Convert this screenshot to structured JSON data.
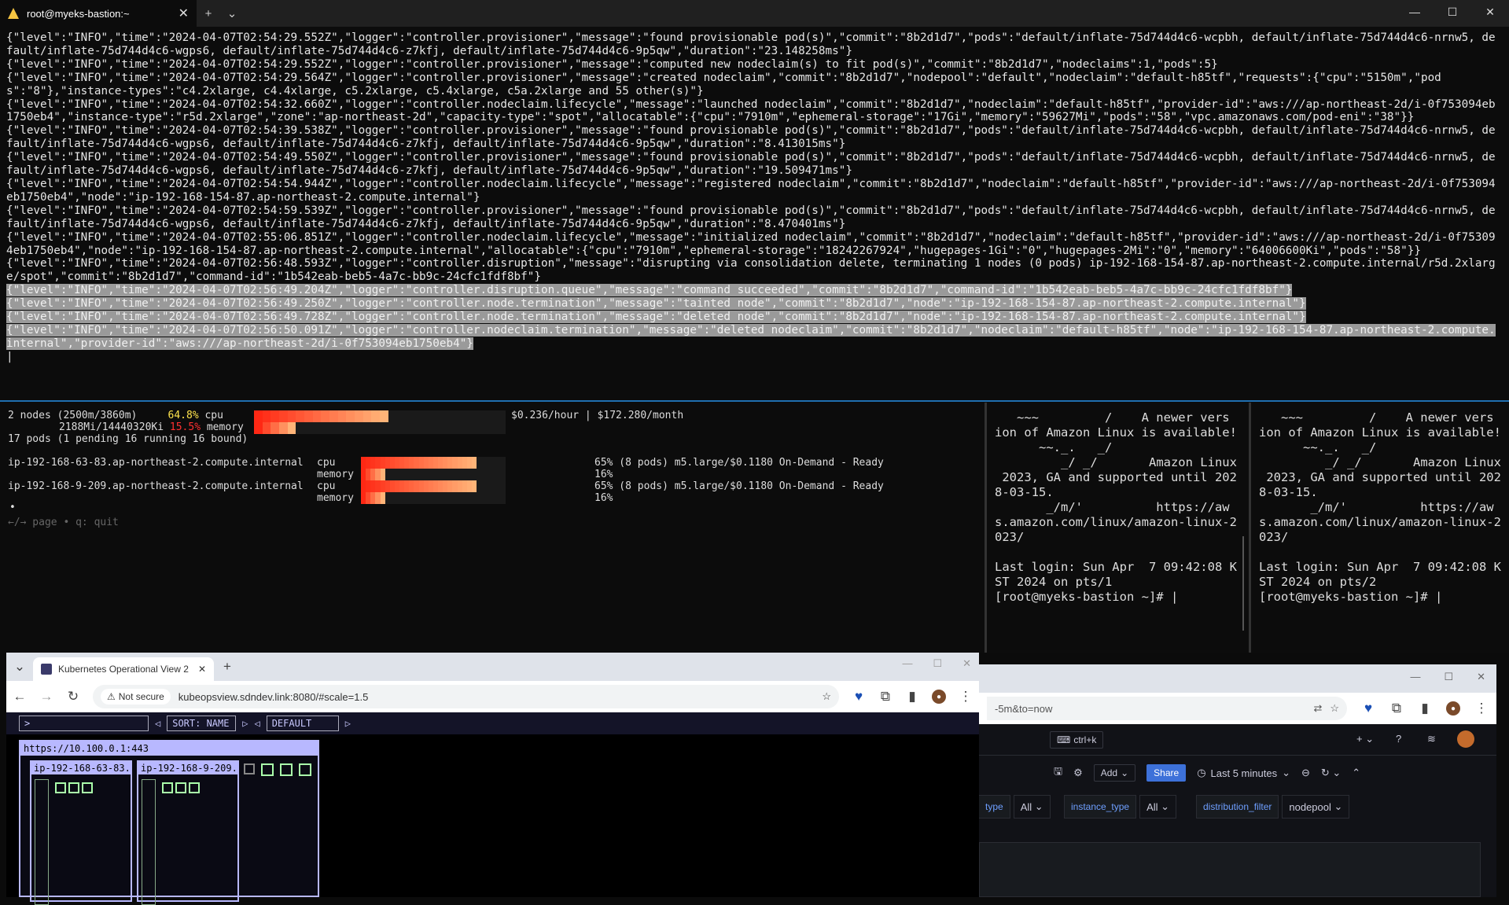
{
  "terminal": {
    "tab_title": "root@myeks-bastion:~",
    "new_tab": "+",
    "dropdown": "⌄",
    "close": "✕",
    "log_lines": [
      "{\"level\":\"INFO\",\"time\":\"2024-04-07T02:54:29.552Z\",\"logger\":\"controller.provisioner\",\"message\":\"found provisionable pod(s)\",\"commit\":\"8b2d1d7\",\"pods\":\"default/inflate-75d744d4c6-wcpbh, default/inflate-75d744d4c6-nrnw5, default/inflate-75d744d4c6-wgps6, default/inflate-75d744d4c6-z7kfj, default/inflate-75d744d4c6-9p5qw\",\"duration\":\"23.148258ms\"}",
      "{\"level\":\"INFO\",\"time\":\"2024-04-07T02:54:29.552Z\",\"logger\":\"controller.provisioner\",\"message\":\"computed new nodeclaim(s) to fit pod(s)\",\"commit\":\"8b2d1d7\",\"nodeclaims\":1,\"pods\":5}",
      "{\"level\":\"INFO\",\"time\":\"2024-04-07T02:54:29.564Z\",\"logger\":\"controller.provisioner\",\"message\":\"created nodeclaim\",\"commit\":\"8b2d1d7\",\"nodepool\":\"default\",\"nodeclaim\":\"default-h85tf\",\"requests\":{\"cpu\":\"5150m\",\"pods\":\"8\"},\"instance-types\":\"c4.2xlarge, c4.4xlarge, c5.2xlarge, c5.4xlarge, c5a.2xlarge and 55 other(s)\"}",
      "{\"level\":\"INFO\",\"time\":\"2024-04-07T02:54:32.660Z\",\"logger\":\"controller.nodeclaim.lifecycle\",\"message\":\"launched nodeclaim\",\"commit\":\"8b2d1d7\",\"nodeclaim\":\"default-h85tf\",\"provider-id\":\"aws:///ap-northeast-2d/i-0f753094eb1750eb4\",\"instance-type\":\"r5d.2xlarge\",\"zone\":\"ap-northeast-2d\",\"capacity-type\":\"spot\",\"allocatable\":{\"cpu\":\"7910m\",\"ephemeral-storage\":\"17Gi\",\"memory\":\"59627Mi\",\"pods\":\"58\",\"vpc.amazonaws.com/pod-eni\":\"38\"}}",
      "{\"level\":\"INFO\",\"time\":\"2024-04-07T02:54:39.538Z\",\"logger\":\"controller.provisioner\",\"message\":\"found provisionable pod(s)\",\"commit\":\"8b2d1d7\",\"pods\":\"default/inflate-75d744d4c6-wcpbh, default/inflate-75d744d4c6-nrnw5, default/inflate-75d744d4c6-wgps6, default/inflate-75d744d4c6-z7kfj, default/inflate-75d744d4c6-9p5qw\",\"duration\":\"8.413015ms\"}",
      "{\"level\":\"INFO\",\"time\":\"2024-04-07T02:54:49.550Z\",\"logger\":\"controller.provisioner\",\"message\":\"found provisionable pod(s)\",\"commit\":\"8b2d1d7\",\"pods\":\"default/inflate-75d744d4c6-wcpbh, default/inflate-75d744d4c6-nrnw5, default/inflate-75d744d4c6-wgps6, default/inflate-75d744d4c6-z7kfj, default/inflate-75d744d4c6-9p5qw\",\"duration\":\"19.509471ms\"}",
      "{\"level\":\"INFO\",\"time\":\"2024-04-07T02:54:54.944Z\",\"logger\":\"controller.nodeclaim.lifecycle\",\"message\":\"registered nodeclaim\",\"commit\":\"8b2d1d7\",\"nodeclaim\":\"default-h85tf\",\"provider-id\":\"aws:///ap-northeast-2d/i-0f753094eb1750eb4\",\"node\":\"ip-192-168-154-87.ap-northeast-2.compute.internal\"}",
      "{\"level\":\"INFO\",\"time\":\"2024-04-07T02:54:59.539Z\",\"logger\":\"controller.provisioner\",\"message\":\"found provisionable pod(s)\",\"commit\":\"8b2d1d7\",\"pods\":\"default/inflate-75d744d4c6-wcpbh, default/inflate-75d744d4c6-nrnw5, default/inflate-75d744d4c6-wgps6, default/inflate-75d744d4c6-z7kfj, default/inflate-75d744d4c6-9p5qw\",\"duration\":\"8.470401ms\"}",
      "{\"level\":\"INFO\",\"time\":\"2024-04-07T02:55:06.851Z\",\"logger\":\"controller.nodeclaim.lifecycle\",\"message\":\"initialized nodeclaim\",\"commit\":\"8b2d1d7\",\"nodeclaim\":\"default-h85tf\",\"provider-id\":\"aws:///ap-northeast-2d/i-0f753094eb1750eb4\",\"node\":\"ip-192-168-154-87.ap-northeast-2.compute.internal\",\"allocatable\":{\"cpu\":\"7910m\",\"ephemeral-storage\":\"18242267924\",\"hugepages-1Gi\":\"0\",\"hugepages-2Mi\":\"0\",\"memory\":\"64006600Ki\",\"pods\":\"58\"}}",
      "{\"level\":\"INFO\",\"time\":\"2024-04-07T02:56:48.593Z\",\"logger\":\"controller.disruption\",\"message\":\"disrupting via consolidation delete, terminating 1 nodes (0 pods) ip-192-168-154-87.ap-northeast-2.compute.internal/r5d.2xlarge/spot\",\"commit\":\"8b2d1d7\",\"command-id\":\"1b542eab-beb5-4a7c-bb9c-24cfc1fdf8bf\"}"
    ],
    "highlight_lines": [
      "{\"level\":\"INFO\",\"time\":\"2024-04-07T02:56:49.204Z\",\"logger\":\"controller.disruption.queue\",\"message\":\"command succeeded\",\"commit\":\"8b2d1d7\",\"command-id\":\"1b542eab-beb5-4a7c-bb9c-24cfc1fdf8bf\"}",
      "{\"level\":\"INFO\",\"time\":\"2024-04-07T02:56:49.250Z\",\"logger\":\"controller.node.termination\",\"message\":\"tainted node\",\"commit\":\"8b2d1d7\",\"node\":\"ip-192-168-154-87.ap-northeast-2.compute.internal\"}",
      "{\"level\":\"INFO\",\"time\":\"2024-04-07T02:56:49.728Z\",\"logger\":\"controller.node.termination\",\"message\":\"deleted node\",\"commit\":\"8b2d1d7\",\"node\":\"ip-192-168-154-87.ap-northeast-2.compute.internal\"}",
      "{\"level\":\"INFO\",\"time\":\"2024-04-07T02:56:50.091Z\",\"logger\":\"controller.nodeclaim.termination\",\"message\":\"deleted nodeclaim\",\"commit\":\"8b2d1d7\",\"nodeclaim\":\"default-h85tf\",\"node\":\"ip-192-168-154-87.ap-northeast-2.compute.internal\",\"provider-id\":\"aws:///ap-northeast-2d/i-0f753094eb1750eb4\"}"
    ]
  },
  "viewer": {
    "summary_line1_a": "2 nodes (2500m/3860m)",
    "cpu_pct": "64.8%",
    "cpu_label": "cpu",
    "summary_line2_a": "2188Mi/14440320Ki",
    "mem_pct": "15.5%",
    "mem_label": "memory",
    "cost": "$0.236/hour | $172.280/month",
    "pods_line": "17 pods (1 pending 16 running 16 bound)",
    "nodes": [
      {
        "name": "ip-192-168-63-83.ap-northeast-2.compute.internal",
        "cpu": "cpu",
        "memory": "memory",
        "cpu_info": "65% (8 pods) m5.large/$0.1180 On-Demand - Ready",
        "mem_info": "16%"
      },
      {
        "name": "ip-192-168-9-209.ap-northeast-2.compute.internal",
        "cpu": "cpu",
        "memory": "memory",
        "cpu_info": "65% (8 pods) m5.large/$0.1180 On-Demand - Ready",
        "mem_info": "16%"
      }
    ],
    "dot": "•",
    "help": "←/→ page • q: quit",
    "summary_cpu_fill": 0.648,
    "summary_mem_fill": 0.155,
    "node_cpu_fill": 0.65,
    "node_mem_fill": 0.16
  },
  "pane_motd": {
    "text": "   ~~~         /    A newer vers\nion of Amazon Linux is available!\n      ~~._.   _/\n         _/ _/       Amazon Linux\n 2023, GA and supported until 202\n8-03-15.\n       _/m/'          https://aw\ns.amazon.com/linux/amazon-linux-2\n023/\n\nLast login: Sun Apr  7 09:42:08 K\nST 2024 on pts/1\n[root@myeks-bastion ~]# |",
    "text2": "   ~~~         /    A newer vers\nion of Amazon Linux is available!\n      ~~._.   _/\n         _/ _/       Amazon Linux\n 2023, GA and supported until 202\n8-03-15.\n       _/m/'          https://aw\ns.amazon.com/linux/amazon-linux-2\n023/\n\nLast login: Sun Apr  7 09:42:08 K\nST 2024 on pts/2\n[root@myeks-bastion ~]# |"
  },
  "chrome_left": {
    "tab_title": "Kubernetes Operational View 2",
    "not_secure": "Not secure",
    "url": "kubeopsview.sdndev.link:8080/#scale=1.5",
    "sort_label": "SORT: NAME",
    "theme_label": "DEFAULT",
    "search_placeholder": ">",
    "cluster_url": "https://10.100.0.1:443",
    "node1": "ip-192-168-63-83...",
    "node2": "ip-192-168-9-209..."
  },
  "chrome_right": {
    "url_fragment": "-5m&to=now",
    "search_hint": "ctrl+k",
    "add": "Add",
    "share": "Share",
    "time_range": "Last 5 minutes",
    "vars": [
      {
        "label": "type",
        "value": "All"
      },
      {
        "label": "instance_type",
        "value": "All"
      },
      {
        "label": "distribution_filter",
        "value": "nodepool"
      }
    ]
  }
}
